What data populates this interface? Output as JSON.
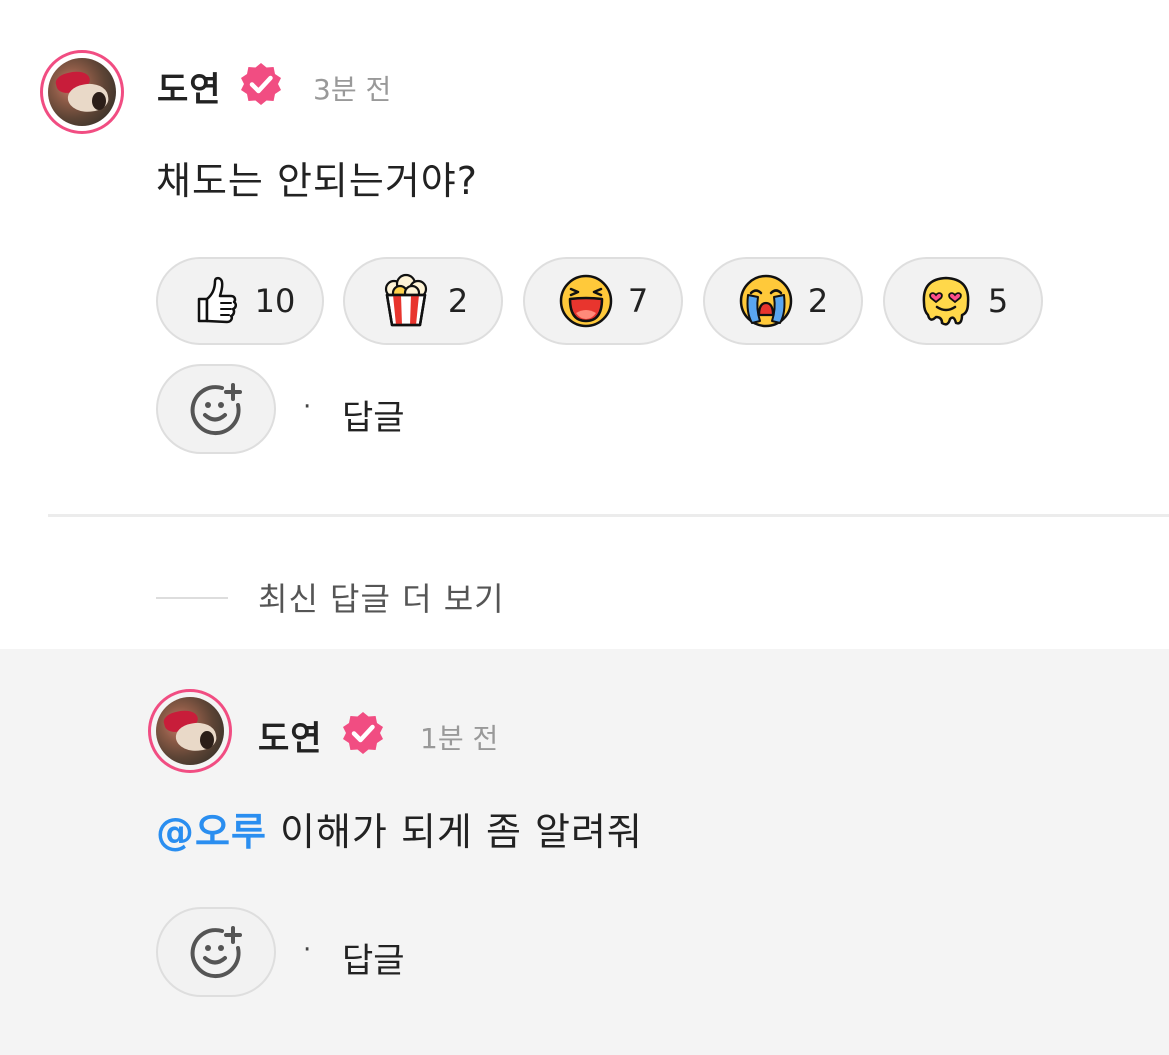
{
  "comment": {
    "author": "도연",
    "time": "3분 전",
    "text": "채도는 안되는거야?",
    "reactions": [
      {
        "icon": "thumbs-up-icon",
        "count": "10"
      },
      {
        "icon": "popcorn-icon",
        "count": "2"
      },
      {
        "icon": "laughing-face-icon",
        "count": "7"
      },
      {
        "icon": "crying-face-icon",
        "count": "2"
      },
      {
        "icon": "heart-eyes-melting-face-icon",
        "count": "5"
      }
    ],
    "add_reaction_icon": "add-reaction-smiley-icon",
    "separator": "·",
    "reply_label": "답글"
  },
  "more_replies": "최신 답글 더 보기",
  "reply": {
    "author": "도연",
    "time": "1분 전",
    "mention": "@오루",
    "text": " 이해가 되게 좀 알려줘",
    "add_reaction_icon": "add-reaction-smiley-icon",
    "separator": "·",
    "reply_label": "답글"
  },
  "colors": {
    "avatar_ring": "#f14d82",
    "verified_badge": "#f14d82",
    "mention": "#2a8ef0",
    "reply_background": "#f4f4f4"
  }
}
